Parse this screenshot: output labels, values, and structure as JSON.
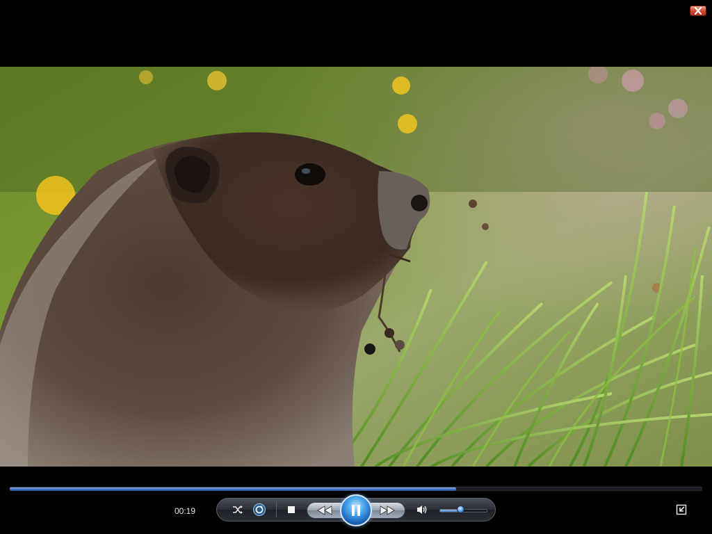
{
  "window": {
    "close_icon": "close-icon"
  },
  "video": {
    "description_icon": "video-frame"
  },
  "playback": {
    "progress": 0.645,
    "current_time": "00:19"
  },
  "controls": {
    "shuffle_icon": "shuffle-icon",
    "repeat_icon": "repeat-icon",
    "stop_icon": "stop-icon",
    "previous_icon": "rewind-icon",
    "play_pause_icon": "pause-icon",
    "next_icon": "fast-forward-icon",
    "mute_icon": "speaker-icon",
    "volume_level": 0.45,
    "fullscreen_icon": "exit-fullscreen-icon"
  },
  "colors": {
    "accent": "#3f6fbf",
    "close": "#d6432c",
    "background": "#000000"
  }
}
